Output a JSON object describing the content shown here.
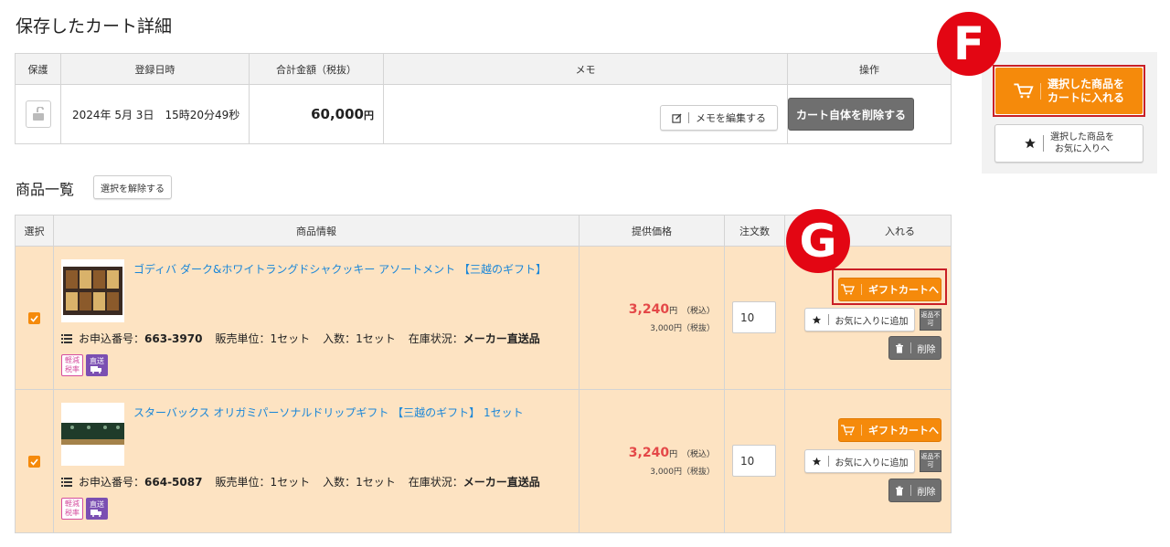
{
  "page_title": "保存したカート詳細",
  "summary": {
    "headers": [
      "保護",
      "登録日時",
      "合計金額（税抜）",
      "メモ",
      "操作"
    ],
    "date": "2024年 5月 3日　15時20分49秒",
    "amount": "60,000",
    "yen": "円",
    "edit_memo_label": "メモを編集する",
    "delete_cart_label": "カート自体を削除する"
  },
  "products_section": {
    "title": "商品一覧",
    "deselect_label": "選択を解除する",
    "headers": [
      "選択",
      "商品情報",
      "提供価格",
      "注文数",
      "入れる"
    ]
  },
  "products": [
    {
      "name": "ゴディバ ダーク&ホワイトラングドシャクッキー アソートメント 【三越のギフト】",
      "order_no_label": "お申込番号：",
      "order_no": "663-3970",
      "unit_label": "販売単位：",
      "unit": "1セット",
      "qty_label": "入数：",
      "qty_count": "1セット",
      "stock_label": "在庫状況：",
      "stock": "メーカー直送品",
      "price": "3,240",
      "yen": "円",
      "tax_in": "（税込）",
      "price_ex": "3,000円（税抜）",
      "quantity": "10",
      "gift_label": "ギフトカートへ",
      "fav_label": "お気に入りに追加",
      "no_return": "返品不可",
      "delete_label": "削除",
      "badge_tax": "軽減税率",
      "badge_direct": "直送"
    },
    {
      "name": "スターバックス オリガミパーソナルドリップギフト 【三越のギフト】 1セット",
      "order_no_label": "お申込番号：",
      "order_no": "664-5087",
      "unit_label": "販売単位：",
      "unit": "1セット",
      "qty_label": "入数：",
      "qty_count": "1セット",
      "stock_label": "在庫状況：",
      "stock": "メーカー直送品",
      "price": "3,240",
      "yen": "円",
      "tax_in": "（税込）",
      "price_ex": "3,000円（税抜）",
      "quantity": "10",
      "gift_label": "ギフトカートへ",
      "fav_label": "お気に入りに追加",
      "no_return": "返品不可",
      "delete_label": "削除",
      "badge_tax": "軽減税率",
      "badge_direct": "直送"
    }
  ],
  "side_panel": {
    "add_cart_line1": "選択した商品を",
    "add_cart_line2": "カートに入れる",
    "add_fav_line1": "選択した商品を",
    "add_fav_line2": "お気に入りへ"
  },
  "markers": {
    "f": "F",
    "g": "G"
  },
  "colors": {
    "accent_orange": "#f58a0b",
    "marker_red": "#e30613",
    "link_blue": "#1a86d8",
    "price_red": "#e44848",
    "row_bg": "#fde3c2"
  }
}
